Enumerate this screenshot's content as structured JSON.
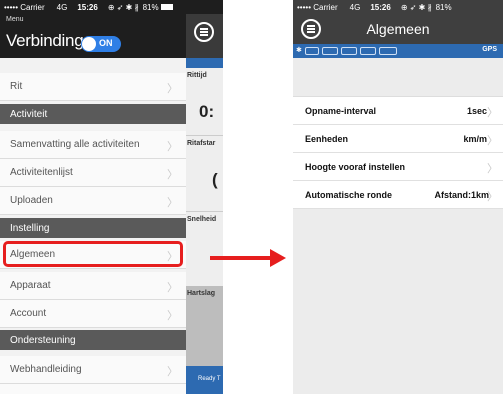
{
  "left": {
    "status": {
      "carrier": "••••• Carrier",
      "network": "4G",
      "time": "15:26",
      "battery": "81%"
    },
    "menu_label": "Menu",
    "title": "Verbinding",
    "toggle_label": "ON",
    "items": {
      "rit": "Rit",
      "activiteit": "Activiteit",
      "samenvatting": "Samenvatting alle activiteiten",
      "activiteitenlijst": "Activiteitenlijst",
      "uploaden": "Uploaden",
      "instelling": "Instelling",
      "algemeen": "Algemeen",
      "apparaat": "Apparaat",
      "account": "Account",
      "ondersteuning": "Ondersteuning",
      "webhandleiding": "Webhandleiding"
    },
    "peek": {
      "rittijd": "Rittijd",
      "big1": "0:",
      "ritafstand": "Ritafstar",
      "big2": "(",
      "snelheid": "Snelheid",
      "hartslag": "Hartslag",
      "ready": "Ready T"
    }
  },
  "right": {
    "status": {
      "carrier": "••••• Carrier",
      "network": "4G",
      "time": "15:26",
      "battery": "81%"
    },
    "title": "Algemeen",
    "gps": "GPS",
    "rows": [
      {
        "label": "Opname-interval",
        "value": "1sec"
      },
      {
        "label": "Eenheden",
        "value": "km/m"
      },
      {
        "label": "Hoogte vooraf instellen",
        "value": ""
      },
      {
        "label": "Automatische ronde",
        "value": "Afstand:1km"
      }
    ]
  },
  "colors": {
    "highlight": "#e61e1e",
    "accent": "#2f7fe6",
    "header": "#1e1e1e",
    "section": "#5a5a5a",
    "blue_bar": "#2d6ab1"
  }
}
